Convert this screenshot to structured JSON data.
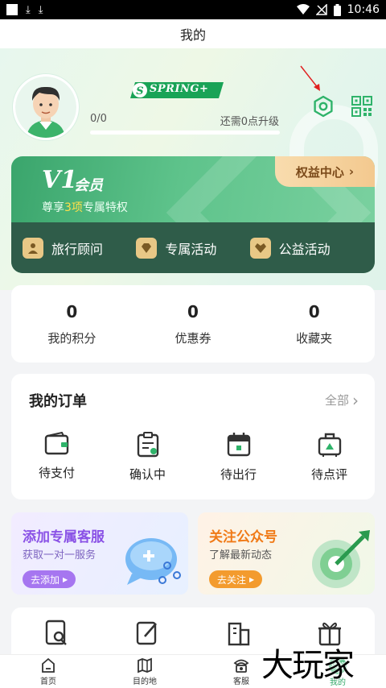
{
  "status_bar": {
    "time": "10:46"
  },
  "title": "我的",
  "profile": {
    "brand": "SPRING+",
    "progress_value": "0/0",
    "progress_hint": "还需0点升级",
    "progress_fraction": 0
  },
  "vip": {
    "level": "V1",
    "level_label": "会员",
    "desc_prefix": "尊享",
    "desc_highlight": "3项",
    "desc_suffix": "专属特权",
    "benefits_button": "权益中心",
    "items": [
      "旅行顾问",
      "专属活动",
      "公益活动"
    ]
  },
  "stats": [
    {
      "value": "0",
      "label": "我的积分"
    },
    {
      "value": "0",
      "label": "优惠券"
    },
    {
      "value": "0",
      "label": "收藏夹"
    }
  ],
  "orders": {
    "title": "我的订单",
    "all_label": "全部",
    "items": [
      "待支付",
      "确认中",
      "待出行",
      "待点评"
    ]
  },
  "promos": {
    "left": {
      "title": "添加专属客服",
      "sub": "获取一对一服务",
      "button": "去添加"
    },
    "right": {
      "title": "关注公众号",
      "sub": "了解最新动态",
      "button": "去关注"
    }
  },
  "tabs": [
    "首页",
    "目的地",
    "客服",
    "我的"
  ],
  "tab_active_badge": "我的",
  "watermark": "大玩家",
  "colors": {
    "accent": "#2fb36a",
    "vip_dark": "#2f5c49",
    "gold": "#f3c98f"
  }
}
